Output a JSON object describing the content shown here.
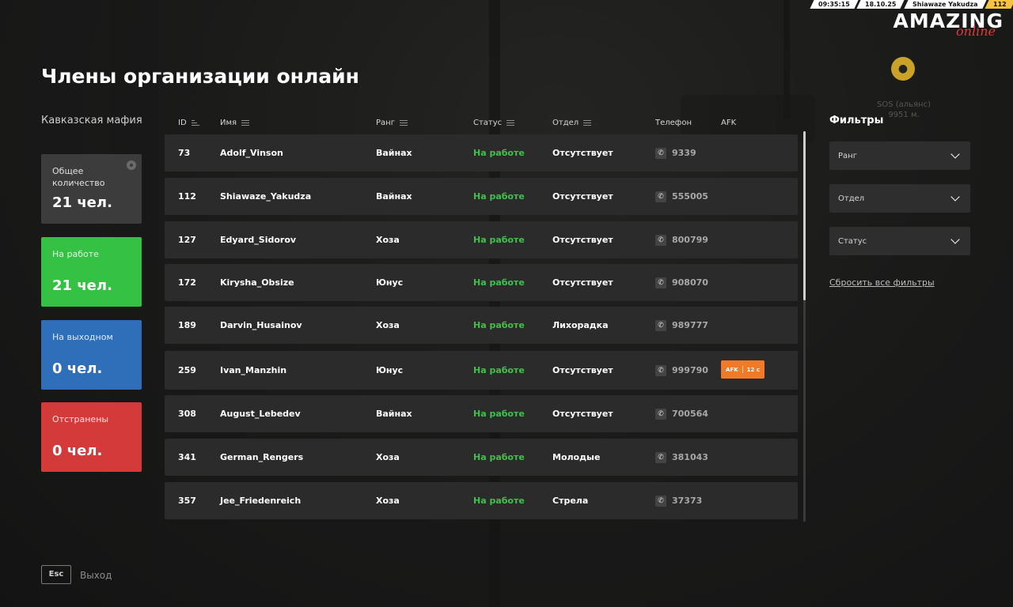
{
  "hud": {
    "time": "09:35:15",
    "date": "18.10.25",
    "player": "Shiawaze Yakudza",
    "level": "112"
  },
  "logo": {
    "line1": "AMAZING",
    "line2": "online"
  },
  "map_marker": {
    "name": "SOS (альянс)",
    "distance": "9951 м."
  },
  "page_title": "Члены организации онлайн",
  "org_name": "Кавказская мафия",
  "stats": [
    {
      "label": "Общее количество",
      "value": "21 чел.",
      "color": "#3c3c3c"
    },
    {
      "label": "На работе",
      "value": "21 чел.",
      "color": "#35c143"
    },
    {
      "label": "На выходном",
      "value": "0 чел.",
      "color": "#2f6fba"
    },
    {
      "label": "Отстранены",
      "value": "0 чел.",
      "color": "#d33a3a"
    }
  ],
  "columns": {
    "id": "ID",
    "name": "Имя",
    "rank": "Ранг",
    "status": "Статус",
    "dept": "Отдел",
    "phone": "Телефон",
    "afk": "AFK"
  },
  "members": [
    {
      "id": "73",
      "name": "Adolf_Vinson",
      "rank": "Вайнах",
      "status": "На работе",
      "dept": "Отсутствует",
      "phone": "9339"
    },
    {
      "id": "112",
      "name": "Shiawaze_Yakudza",
      "rank": "Вайнах",
      "status": "На работе",
      "dept": "Отсутствует",
      "phone": "555005"
    },
    {
      "id": "127",
      "name": "Edyard_Sidorov",
      "rank": "Хоза",
      "status": "На работе",
      "dept": "Отсутствует",
      "phone": "800799"
    },
    {
      "id": "172",
      "name": "Kirysha_Obsize",
      "rank": "Юнус",
      "status": "На работе",
      "dept": "Отсутствует",
      "phone": "908070"
    },
    {
      "id": "189",
      "name": "Darvin_Husainov",
      "rank": "Хоза",
      "status": "На работе",
      "dept": "Лихорадка",
      "phone": "989777"
    },
    {
      "id": "259",
      "name": "Ivan_Manzhin",
      "rank": "Юнус",
      "status": "На работе",
      "dept": "Отсутствует",
      "phone": "999790",
      "afk_label": "AFK",
      "afk_time": "12 с"
    },
    {
      "id": "308",
      "name": "August_Lebedev",
      "rank": "Вайнах",
      "status": "На работе",
      "dept": "Отсутствует",
      "phone": "700564"
    },
    {
      "id": "341",
      "name": "German_Rengers",
      "rank": "Хоза",
      "status": "На работе",
      "dept": "Молодые",
      "phone": "381043"
    },
    {
      "id": "357",
      "name": "Jee_Friedenreich",
      "rank": "Хоза",
      "status": "На работе",
      "dept": "Стрела",
      "phone": "37373"
    }
  ],
  "filters": {
    "title": "Фильтры",
    "rank": "Ранг",
    "dept": "Отдел",
    "status": "Статус",
    "reset": "Сбросить все фильтры"
  },
  "footer": {
    "key": "Esc",
    "label": "Выход"
  },
  "colors": {
    "working": "#3fc14b",
    "afk": "#f07a28",
    "brand_red": "#e03a3a"
  }
}
